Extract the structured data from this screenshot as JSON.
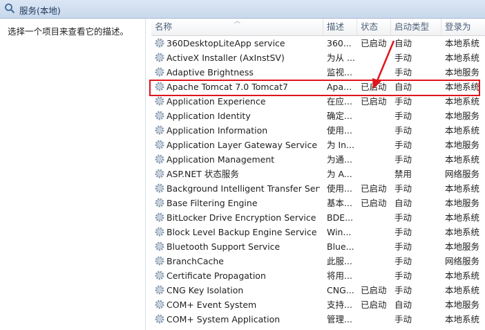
{
  "window": {
    "title": "服务(本地)"
  },
  "left_pane": {
    "description": "选择一个项目来查看它的描述。"
  },
  "columns": {
    "name": "名称",
    "desc": "描述",
    "status": "状态",
    "startup": "启动类型",
    "logon": "登录为"
  },
  "services": [
    {
      "name": "360DesktopLiteApp service",
      "desc": "360...",
      "status": "已启动",
      "startup": "自动",
      "logon": "本地系统"
    },
    {
      "name": "ActiveX Installer (AxInstSV)",
      "desc": "为从 ...",
      "status": "",
      "startup": "手动",
      "logon": "本地系统"
    },
    {
      "name": "Adaptive Brightness",
      "desc": "监视...",
      "status": "",
      "startup": "手动",
      "logon": "本地服务"
    },
    {
      "name": "Apache Tomcat 7.0 Tomcat7",
      "desc": "Apa...",
      "status": "已启动",
      "startup": "自动",
      "logon": "本地系统"
    },
    {
      "name": "Application Experience",
      "desc": "在应...",
      "status": "已启动",
      "startup": "手动",
      "logon": "本地系统"
    },
    {
      "name": "Application Identity",
      "desc": "确定...",
      "status": "",
      "startup": "手动",
      "logon": "本地服务"
    },
    {
      "name": "Application Information",
      "desc": "使用...",
      "status": "",
      "startup": "手动",
      "logon": "本地系统"
    },
    {
      "name": "Application Layer Gateway Service",
      "desc": "为 In...",
      "status": "",
      "startup": "手动",
      "logon": "本地服务"
    },
    {
      "name": "Application Management",
      "desc": "为通...",
      "status": "",
      "startup": "手动",
      "logon": "本地系统"
    },
    {
      "name": "ASP.NET 状态服务",
      "desc": "为 A...",
      "status": "",
      "startup": "禁用",
      "logon": "网络服务"
    },
    {
      "name": "Background Intelligent Transfer Serv...",
      "desc": "使用...",
      "status": "已启动",
      "startup": "手动",
      "logon": "本地系统"
    },
    {
      "name": "Base Filtering Engine",
      "desc": "基本...",
      "status": "已启动",
      "startup": "自动",
      "logon": "本地服务"
    },
    {
      "name": "BitLocker Drive Encryption Service",
      "desc": "BDE...",
      "status": "",
      "startup": "手动",
      "logon": "本地系统"
    },
    {
      "name": "Block Level Backup Engine Service",
      "desc": "Win...",
      "status": "",
      "startup": "手动",
      "logon": "本地系统"
    },
    {
      "name": "Bluetooth Support Service",
      "desc": "Blue...",
      "status": "",
      "startup": "手动",
      "logon": "本地服务"
    },
    {
      "name": "BranchCache",
      "desc": "此服...",
      "status": "",
      "startup": "手动",
      "logon": "网络服务"
    },
    {
      "name": "Certificate Propagation",
      "desc": "将用...",
      "status": "",
      "startup": "手动",
      "logon": "本地系统"
    },
    {
      "name": "CNG Key Isolation",
      "desc": "CNG...",
      "status": "已启动",
      "startup": "手动",
      "logon": "本地系统"
    },
    {
      "name": "COM+ Event System",
      "desc": "支持...",
      "status": "已启动",
      "startup": "自动",
      "logon": "本地服务"
    },
    {
      "name": "COM+ System Application",
      "desc": "管理...",
      "status": "",
      "startup": "手动",
      "logon": "本地系统"
    }
  ],
  "colors": {
    "highlight": "#e0141c",
    "header_text": "#4c607a"
  }
}
